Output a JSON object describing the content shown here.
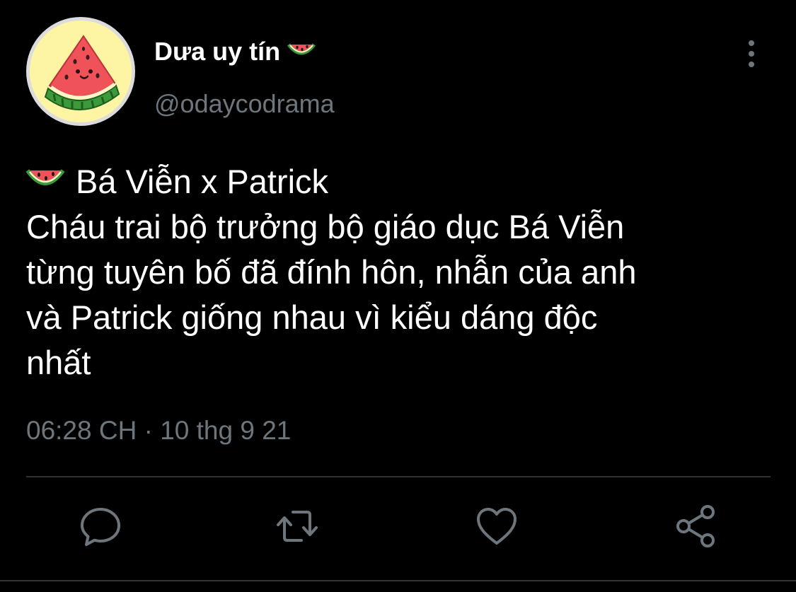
{
  "author": {
    "display_name": "Dưa uy tín",
    "handle": "@odaycodrama",
    "name_emoji": "watermelon-icon",
    "avatar": "watermelon-avatar"
  },
  "tweet": {
    "headline_emoji": "watermelon-icon",
    "headline": "Bá Viễn x Patrick",
    "lines": [
      "Cháu trai bộ trưởng bộ giáo dục Bá Viễn",
      "từng tuyên bố đã đính hôn, nhẫn của anh",
      "và Patrick giống nhau vì kiểu dáng độc",
      "nhất"
    ],
    "time": "06:28 CH",
    "separator": "·",
    "date": "10 thg 9 21"
  },
  "actions": [
    {
      "name": "reply",
      "icon": "comment-icon"
    },
    {
      "name": "retweet",
      "icon": "retweet-icon"
    },
    {
      "name": "like",
      "icon": "heart-icon"
    },
    {
      "name": "share",
      "icon": "share-icon"
    }
  ],
  "colors": {
    "background": "#000000",
    "text": "#ffffff",
    "secondary_text": "#6e767d",
    "divider": "#2f3336",
    "icon": "#6e767d",
    "avatar_bg": "#fdf5a4"
  }
}
